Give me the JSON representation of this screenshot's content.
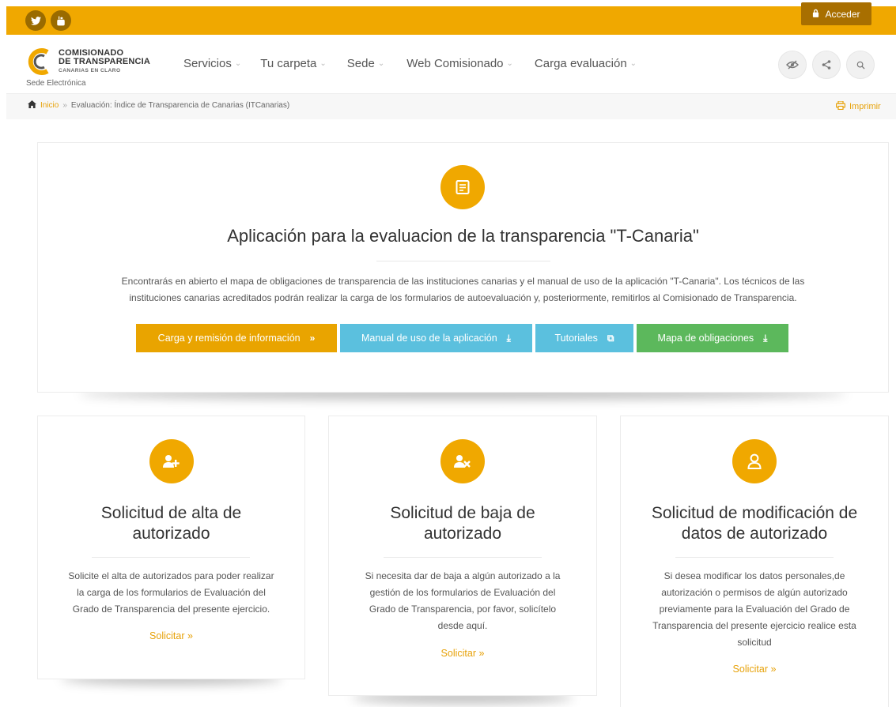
{
  "topbar": {
    "social": [
      {
        "name": "twitter-icon",
        "glyph": "t"
      },
      {
        "name": "youtube-icon",
        "glyph": "▶"
      }
    ],
    "login_label": "Acceder"
  },
  "header": {
    "logo_line1": "COMISIONADO",
    "logo_line2": "DE TRANSPARENCIA",
    "logo_line3": "CANARIAS EN CLARO",
    "sede_label": "Sede Electrónica",
    "menu": [
      {
        "label": "Servicios"
      },
      {
        "label": "Tu carpeta"
      },
      {
        "label": "Sede"
      },
      {
        "label": "Web Comisionado"
      },
      {
        "label": "Carga evaluación"
      }
    ]
  },
  "breadcrumb": {
    "home": "Inicio",
    "separator": "»",
    "current": "Evaluación: Índice de Transparencia de Canarias (ITCanarias)",
    "print_label": "Imprimir"
  },
  "main": {
    "title": "Aplicación para la evaluacion de la transparencia \"T-Canaria\"",
    "description_line1": "Encontrarás en abierto el mapa de obligaciones de transparencia de las instituciones canarias y el manual de uso de la aplicación \"T-Canaria\". Los técnicos de las",
    "description_line2": "instituciones canarias acreditados podrán realizar la carga de los formularios de autoevaluación y, posteriormente, remitirlos al Comisionado de Transparencia.",
    "buttons": [
      {
        "label": "Carga y remisión de información",
        "icon": "»",
        "color": "#e9a400"
      },
      {
        "label": "Manual de uso de la aplicación",
        "icon": "⤓",
        "color": "#5bc0de"
      },
      {
        "label": "Tutoriales",
        "icon": "⧉",
        "color": "#5bc0de"
      },
      {
        "label": "Mapa de obligaciones",
        "icon": "⤓",
        "color": "#5cb85c"
      }
    ]
  },
  "cards": [
    {
      "title_line1": "Solicitud de alta de",
      "title_line2": "autorizado",
      "desc": [
        "Solicite el alta de autorizados para poder realizar",
        "la carga de los formularios de Evaluación del",
        "Grado de Transparencia del presente ejercicio."
      ],
      "link": "Solicitar »"
    },
    {
      "title_line1": "Solicitud de baja de",
      "title_line2": "autorizado",
      "desc": [
        "Si necesita dar de baja a algún autorizado a la",
        "gestión de los formularios de Evaluación del",
        "Grado de Transparencia, por favor, solicítelo",
        "desde aquí."
      ],
      "link": "Solicitar »"
    },
    {
      "title_line1": "Solicitud de modificación de",
      "title_line2": "datos de autorizado",
      "desc": [
        "Si desea modificar los datos personales,de",
        "autorización o permisos de algún autorizado",
        "previamente para la Evaluación del Grado de",
        "Transparencia del presente ejercicio realice esta",
        "solicitud"
      ],
      "link": "Solicitar »"
    }
  ],
  "colors": {
    "accent": "#f0a800",
    "link": "#e7a20a",
    "info": "#5bc0de",
    "success": "#5cb85c"
  }
}
